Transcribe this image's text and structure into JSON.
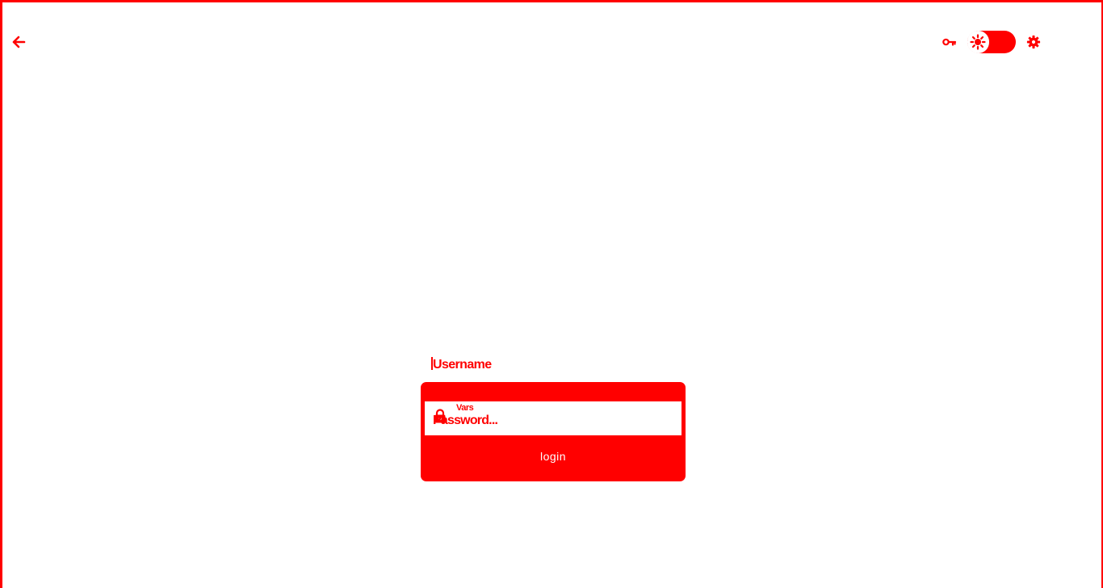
{
  "colors": {
    "accent": "#ff0000",
    "background": "#ffffff",
    "button_text": "#ffffff"
  },
  "toolbar": {
    "back_icon": "arrow-left-icon",
    "key_icon": "key-icon",
    "theme_toggle_icon": "sun-icon",
    "settings_icon": "gear-icon"
  },
  "login": {
    "username_label": "Username",
    "password_hint": "Vars",
    "password_placeholder": "Password...",
    "password_value": "",
    "lock_icon": "lock-icon",
    "login_label": "login"
  }
}
